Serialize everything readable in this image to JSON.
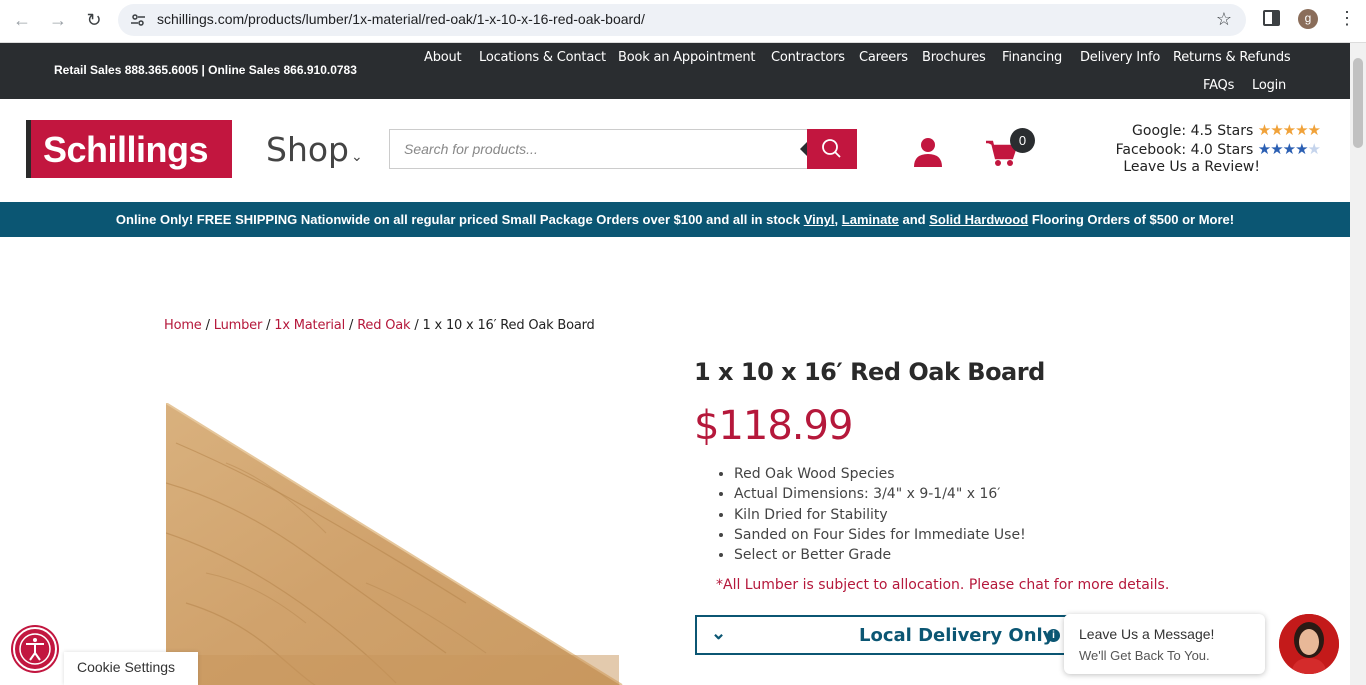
{
  "browser": {
    "url": "schillings.com/products/lumber/1x-material/red-oak/1-x-10-x-16-red-oak-board/",
    "profile_initial": "g"
  },
  "topbar": {
    "phones": "Retail Sales 888.365.6005 | Online Sales 866.910.0783",
    "nav": [
      "About",
      "Locations & Contact",
      "Book an Appointment",
      "Contractors",
      "Careers",
      "Brochures",
      "Financing",
      "Delivery Info",
      "Returns & Refunds",
      "FAQs",
      "Login"
    ]
  },
  "header": {
    "logo_text": "Schillings",
    "shop_label": "Shop",
    "search_placeholder": "Search for products...",
    "cart_count": "0",
    "ratings": {
      "google": "Google: 4.5 Stars",
      "facebook": "Facebook: 4.0 Stars",
      "review": "Leave Us a Review!"
    }
  },
  "promo": {
    "before": "Online Only! FREE SHIPPING Nationwide on all regular priced Small Package Orders over $100 and all in stock",
    "link1": "Vinyl",
    "sep1": ",",
    "link2": "Laminate",
    "and": "and",
    "link3": "Solid Hardwood",
    "after": "Flooring Orders of $500 or More!"
  },
  "breadcrumb": {
    "items": [
      "Home",
      "Lumber",
      "1x Material",
      "Red Oak"
    ],
    "current": "1 x 10 x 16′ Red Oak Board"
  },
  "product": {
    "title": "1 x 10 x 16′ Red Oak Board",
    "price": "$118.99",
    "features": [
      "Red Oak Wood Species",
      "Actual Dimensions: 3/4\" x 9-1/4\" x 16′",
      "Kiln Dried for Stability",
      "Sanded on Four Sides for Immediate Use!",
      "Select or Better Grade"
    ],
    "note": "*All Lumber is subject to allocation. Please chat for more details.",
    "delivery_label": "Local Delivery Only"
  },
  "chat": {
    "line1": "Leave Us a Message!",
    "line2": "We'll Get Back To You."
  },
  "cookie_label": "Cookie Settings",
  "colors": {
    "brand_red": "#c2163f",
    "teal": "#0b5673",
    "dark": "#2a2d30"
  }
}
